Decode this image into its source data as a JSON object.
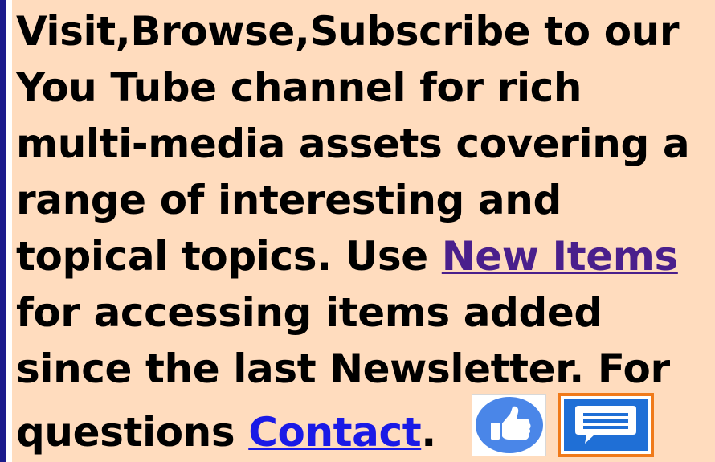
{
  "paragraph": {
    "line1": "Visit,Browse,Subscribe to our",
    "line2": "You Tube channel for rich",
    "line3": "multi-media assets covering a",
    "line4": "range of interesting and",
    "line5_prefix": "topical topics. Use ",
    "new_items_link": "New Items",
    "line6": "for accessing items added",
    "line7": "since the last Newsletter. For",
    "line8_prefix": "questions ",
    "contact_link": "Contact",
    "line8_suffix": "."
  },
  "icons": {
    "like": "thumbs-up-icon",
    "comment": "comment-icon"
  },
  "colors": {
    "background": "#ffdcbe",
    "visited_link": "#4a1f8c",
    "link": "#1a1ae6",
    "like_circle": "#4a86e8",
    "comment_blue": "#1f6fd6",
    "comment_border": "#f07a1a"
  }
}
